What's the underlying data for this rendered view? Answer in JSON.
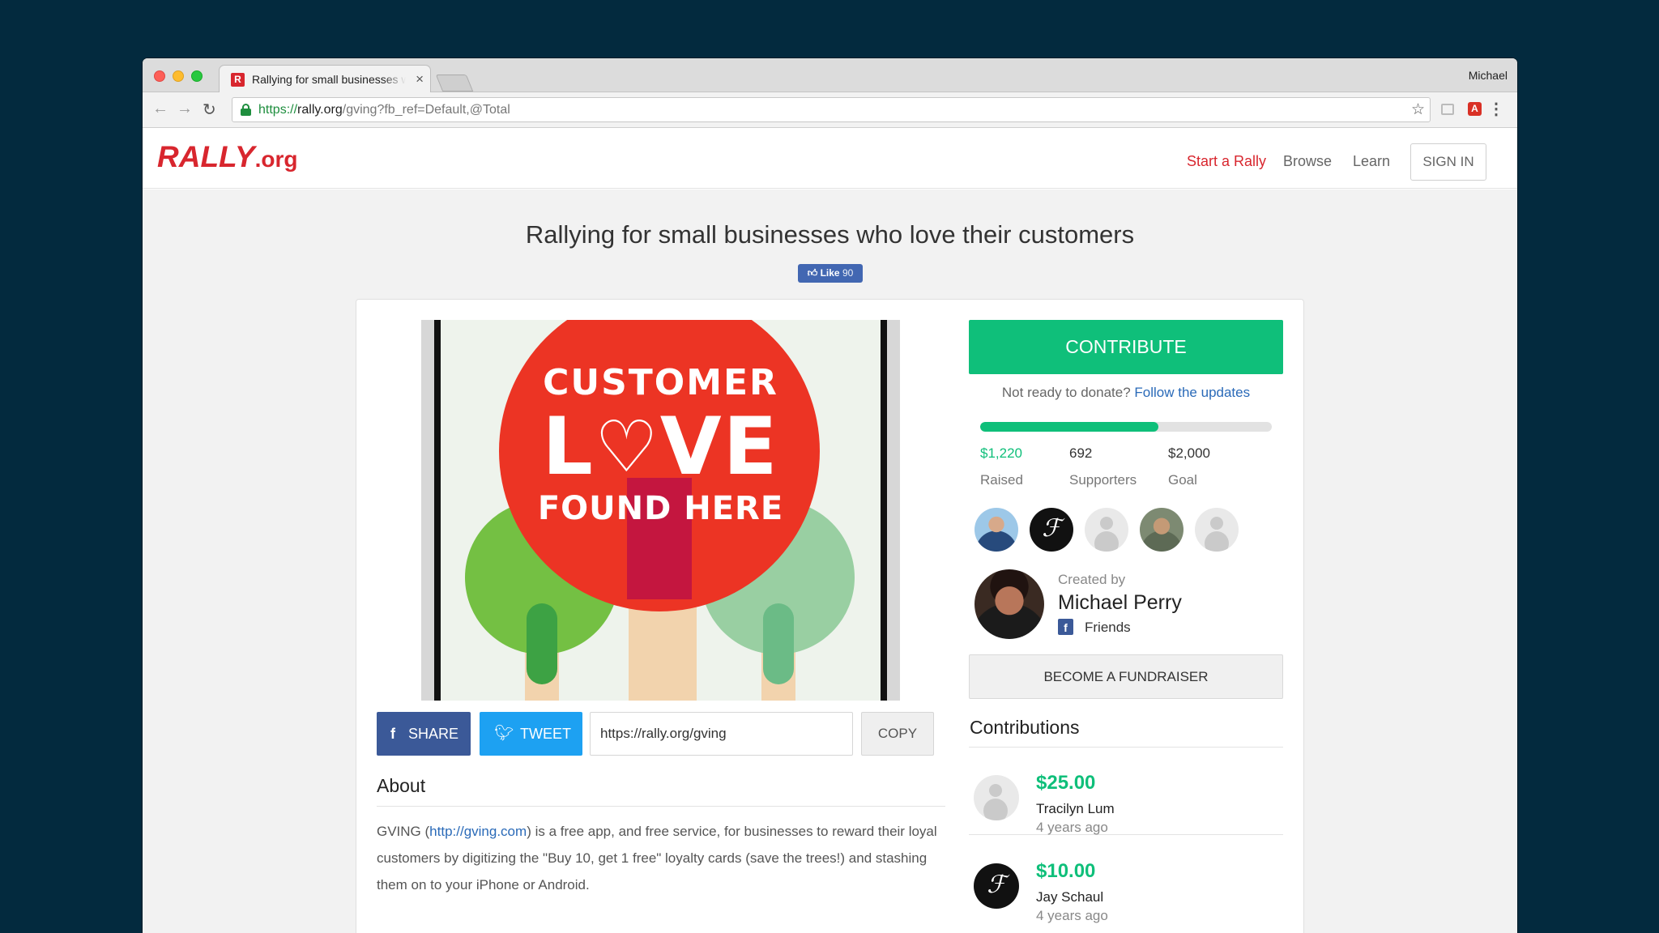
{
  "browser": {
    "tab_title": "Rallying for small businesses who love their customers",
    "profile_name": "Michael",
    "url_scheme": "https://",
    "url_host": "rally.org",
    "url_path": "/gving?fb_ref=Default,@Total"
  },
  "header": {
    "logo_main": "RALLY",
    "logo_suffix": ".org",
    "nav": [
      "Start a Rally",
      "Browse",
      "Learn"
    ],
    "sign_in": "SIGN IN"
  },
  "page": {
    "headline": "Rallying for small businesses who love their customers",
    "fb_like_label": "Like",
    "fb_like_count": "90"
  },
  "hero": {
    "line1": "CUSTOMER",
    "line2_left": "L",
    "line2_right": "VE",
    "line3": "FOUND HERE"
  },
  "share": {
    "share_label": "SHARE",
    "tweet_label": "TWEET",
    "url": "https://rally.org/gving",
    "copy_label": "COPY"
  },
  "about": {
    "title": "About",
    "text_before_link": "GVING (",
    "link": "http://gving.com",
    "text_after_link": ") is a free app, and free service, for businesses to reward their loyal customers by digitizing the \"Buy 10, get 1 free\" loyalty cards (save the trees!) and stashing them on to your iPhone or Android."
  },
  "campaign": {
    "contribute_label": "CONTRIBUTE",
    "not_ready_text": "Not ready to donate?",
    "follow_link": "Follow the updates",
    "progress_fraction": 0.61,
    "raised_value": "$1,220",
    "raised_label": "Raised",
    "supporters_value": "692",
    "supporters_label": "Supporters",
    "goal_value": "$2,000",
    "goal_label": "Goal"
  },
  "creator": {
    "created_by_label": "Created by",
    "name": "Michael Perry",
    "network": "Friends"
  },
  "fundraiser_label": "BECOME A FUNDRAISER",
  "contributions": {
    "title": "Contributions",
    "items": [
      {
        "amount": "$25.00",
        "name": "Tracilyn Lum",
        "time": "4 years ago"
      },
      {
        "amount": "$10.00",
        "name": "Jay Schaul",
        "time": "4 years ago"
      }
    ]
  },
  "colors": {
    "brand_red": "#d8262e",
    "accent_green": "#0fbf7a",
    "facebook_blue": "#3b5998",
    "twitter_blue": "#1da1f2",
    "link_blue": "#2a6ab8"
  },
  "icons": [
    "lock-icon",
    "star-icon",
    "facebook-icon",
    "twitter-icon",
    "thumbs-up-icon",
    "reload-icon",
    "back-icon",
    "forward-icon",
    "menu-icon"
  ]
}
